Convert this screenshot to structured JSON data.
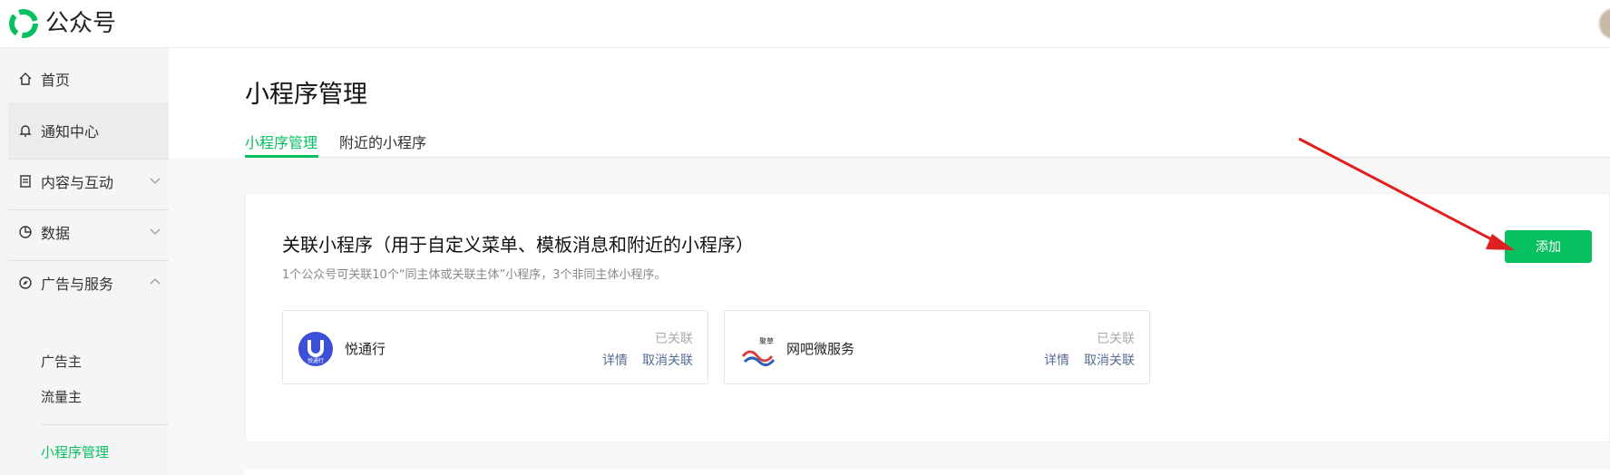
{
  "header": {
    "brand": "公众号"
  },
  "sidebar": {
    "items": [
      {
        "label": "首页",
        "icon": "home-icon"
      },
      {
        "label": "通知中心",
        "icon": "bell-icon"
      },
      {
        "label": "内容与互动",
        "icon": "document-icon"
      },
      {
        "label": "数据",
        "icon": "pie-chart-icon"
      },
      {
        "label": "广告与服务",
        "icon": "compass-icon"
      }
    ],
    "sub_items": [
      {
        "label": "广告主"
      },
      {
        "label": "流量主"
      },
      {
        "label": "小程序管理"
      }
    ]
  },
  "main": {
    "title": "小程序管理",
    "tabs": [
      {
        "label": "小程序管理"
      },
      {
        "label": "附近的小程序"
      }
    ],
    "section": {
      "title": "关联小程序（用于自定义菜单、模板消息和附近的小程序）",
      "desc": "1个公众号可关联10个“同主体或关联主体”小程序，3个非同主体小程序。",
      "add_label": "添加"
    },
    "mini_programs": [
      {
        "name": "悦通行",
        "status": "已关联",
        "detail": "详情",
        "unlink": "取消关联",
        "logo_text": "悦通行"
      },
      {
        "name": "网吧微服务",
        "status": "已关联",
        "detail": "详情",
        "unlink": "取消关联",
        "logo_text": "聚草"
      }
    ]
  },
  "colors": {
    "accent": "#07c160",
    "link": "#576b95",
    "arrow": "#e02020"
  }
}
